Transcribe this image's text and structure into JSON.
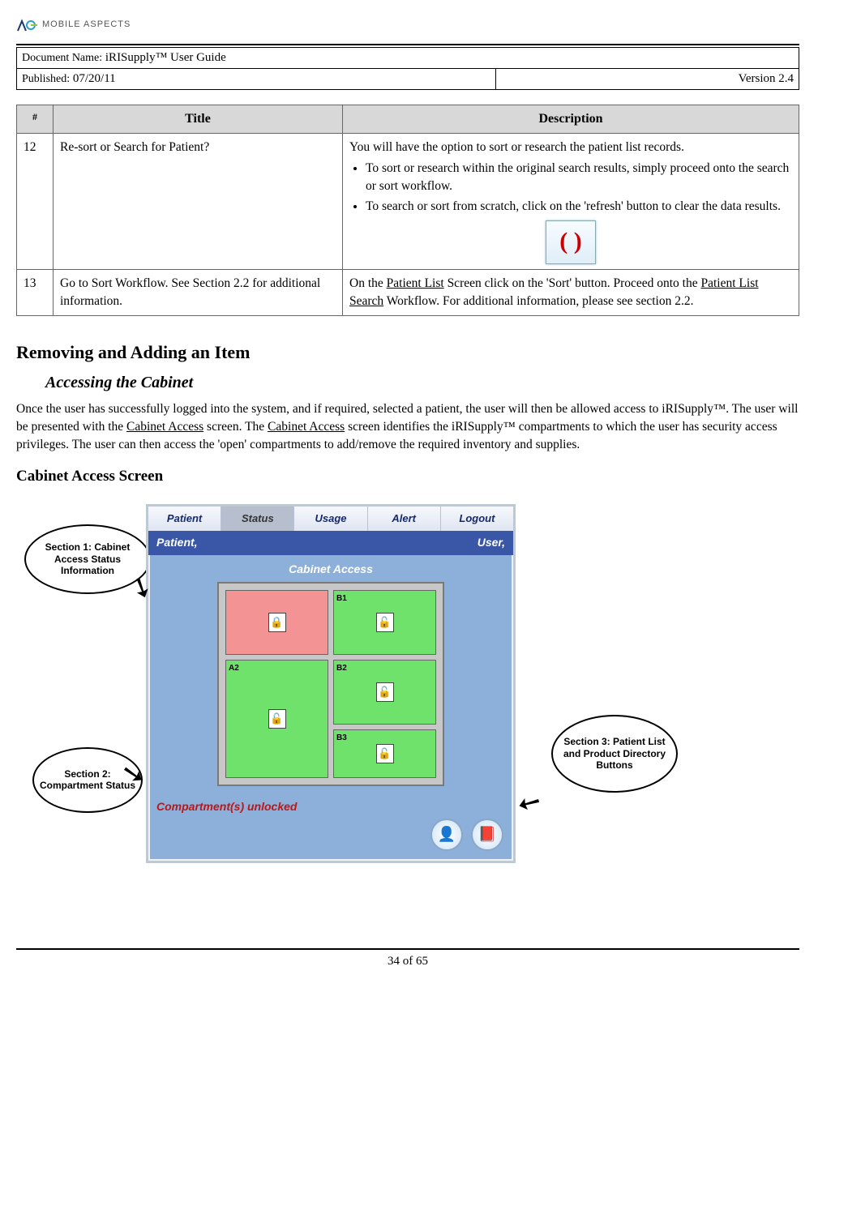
{
  "logo_text": "MOBILE ASPECTS",
  "meta": {
    "doc_name_label": "Document Name:",
    "doc_name": "iRISupply™ User Guide",
    "published_label": "Published:",
    "published_date": "07/20/11",
    "version": "Version 2.4"
  },
  "table": {
    "headers": {
      "num": "#",
      "title": "Title",
      "desc": "Description"
    },
    "rows": [
      {
        "num": "12",
        "title": "Re-sort or Search for Patient?",
        "desc_intro": "You will have the option to sort or research the patient list records.",
        "bullets": [
          "To sort or research within the original search results, simply proceed onto the search or sort workflow.",
          "To search or sort from scratch, click on the 'refresh' button to clear the data results."
        ],
        "refresh_glyph": "( )"
      },
      {
        "num": "13",
        "title": "Go to Sort Workflow.  See Section 2.2 for additional information.",
        "desc_pre": "On the ",
        "desc_u1": "Patient List",
        "desc_mid1": " Screen click on the 'Sort' button.  Proceed onto the ",
        "desc_u2": "Patient List Search",
        "desc_mid2": " Workflow.  For additional information, please see section 2.2."
      }
    ]
  },
  "headings": {
    "h2": "Removing and Adding an Item",
    "h3_sub": "Accessing the Cabinet",
    "h3_plain": "Cabinet Access Screen"
  },
  "paragraph": {
    "p1_a": "Once the user has successfully logged into the system, and if required, selected a patient, the user will then be allowed access to iRISupply™.  The user will be presented with the ",
    "p1_u1": "Cabinet Access",
    "p1_b": " screen.  The ",
    "p1_u2": "Cabinet Access",
    "p1_c": " screen identifies the iRISupply™ compartments to which the user has security access privileges.  The user can then access the 'open' compartments to add/remove the required inventory and supplies."
  },
  "callouts": {
    "c1": "Section 1: Cabinet Access Status Information",
    "c2": "Section 2: Compartment Status",
    "c3": "Section 3: Patient List and Product Directory Buttons"
  },
  "app": {
    "tabs": [
      "Patient",
      "Status",
      "Usage",
      "Alert",
      "Logout"
    ],
    "active_tab_index": 1,
    "patient_label": "Patient,",
    "user_label": "User,",
    "section_title": "Cabinet Access",
    "compartments": {
      "a1_locked": true,
      "labels": {
        "b1": "B1",
        "a2": "A2",
        "b2": "B2",
        "b3": "B3"
      }
    },
    "status_text": "Compartment(s) unlocked",
    "icon_person": "👤",
    "icon_book": "📕"
  },
  "footer": {
    "page": "34 of 65"
  }
}
